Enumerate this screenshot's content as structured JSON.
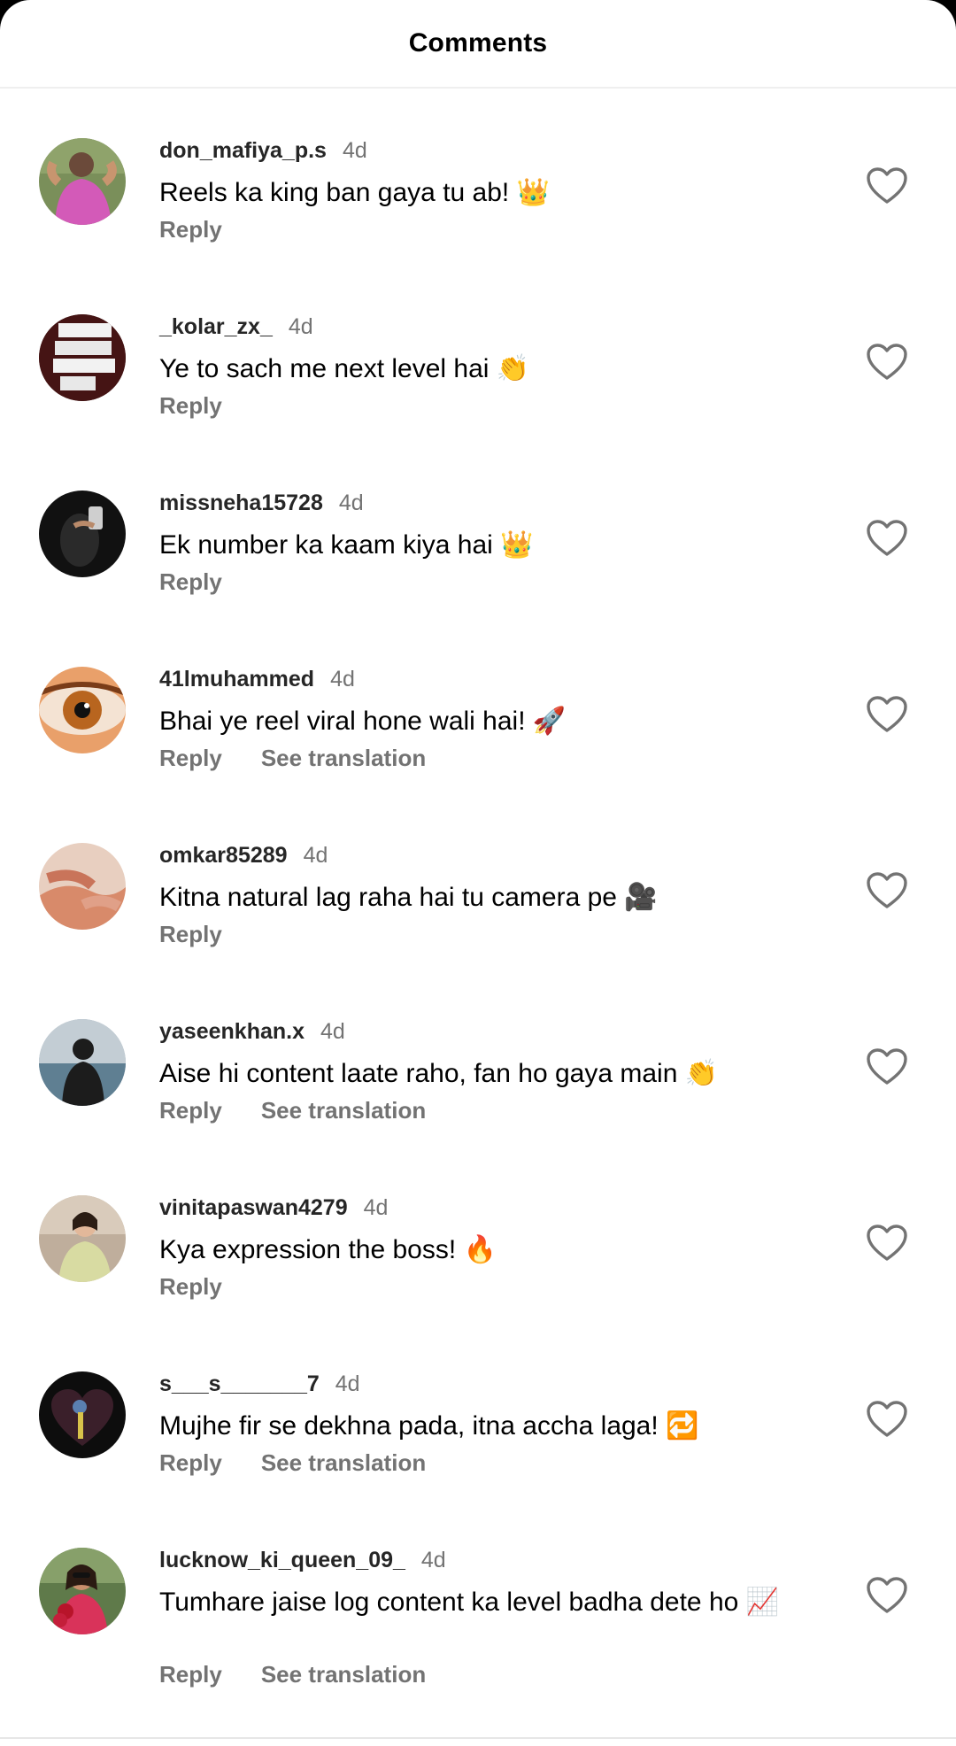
{
  "header": {
    "title": "Comments"
  },
  "comments": [
    {
      "username": "don_mafiya_p.s",
      "time": "4d",
      "text": "Reels ka king ban gaya tu ab!",
      "emoji": "👑",
      "reply_label": "Reply",
      "translation_label": ""
    },
    {
      "username": "_kolar_zx_",
      "time": "4d",
      "text": "Ye to sach me next level hai",
      "emoji": "👏",
      "reply_label": "Reply",
      "translation_label": ""
    },
    {
      "username": "missneha15728",
      "time": "4d",
      "text": "Ek number ka kaam kiya hai",
      "emoji": "👑",
      "reply_label": "Reply",
      "translation_label": ""
    },
    {
      "username": "41lmuhammed",
      "time": "4d",
      "text": "Bhai ye reel viral hone wali hai!",
      "emoji": "🚀",
      "reply_label": "Reply",
      "translation_label": "See translation"
    },
    {
      "username": "omkar85289",
      "time": "4d",
      "text": "Kitna natural lag raha hai tu camera pe",
      "emoji": "🎥",
      "reply_label": "Reply",
      "translation_label": ""
    },
    {
      "username": "yaseenkhan.x",
      "time": "4d",
      "text": "Aise hi content laate raho, fan ho gaya main",
      "emoji": "👏",
      "reply_label": "Reply",
      "translation_label": "See translation"
    },
    {
      "username": "vinitapaswan4279",
      "time": "4d",
      "text": "Kya expression the boss!",
      "emoji": "🔥",
      "reply_label": "Reply",
      "translation_label": ""
    },
    {
      "username": "s___s_______7",
      "time": "4d",
      "text": "Mujhe fir se dekhna pada, itna accha laga!",
      "emoji": "🔁",
      "reply_label": "Reply",
      "translation_label": "See translation"
    },
    {
      "username": "lucknow_ki_queen_09_",
      "time": "4d",
      "text": "Tumhare jaise log content ka level badha dete ho",
      "emoji": "📈",
      "reply_label": "Reply",
      "translation_label": "See translation"
    }
  ],
  "icons": {
    "like": "heart-outline-icon"
  },
  "colors": {
    "secondary_text": "#737373",
    "username_text": "#262626"
  }
}
